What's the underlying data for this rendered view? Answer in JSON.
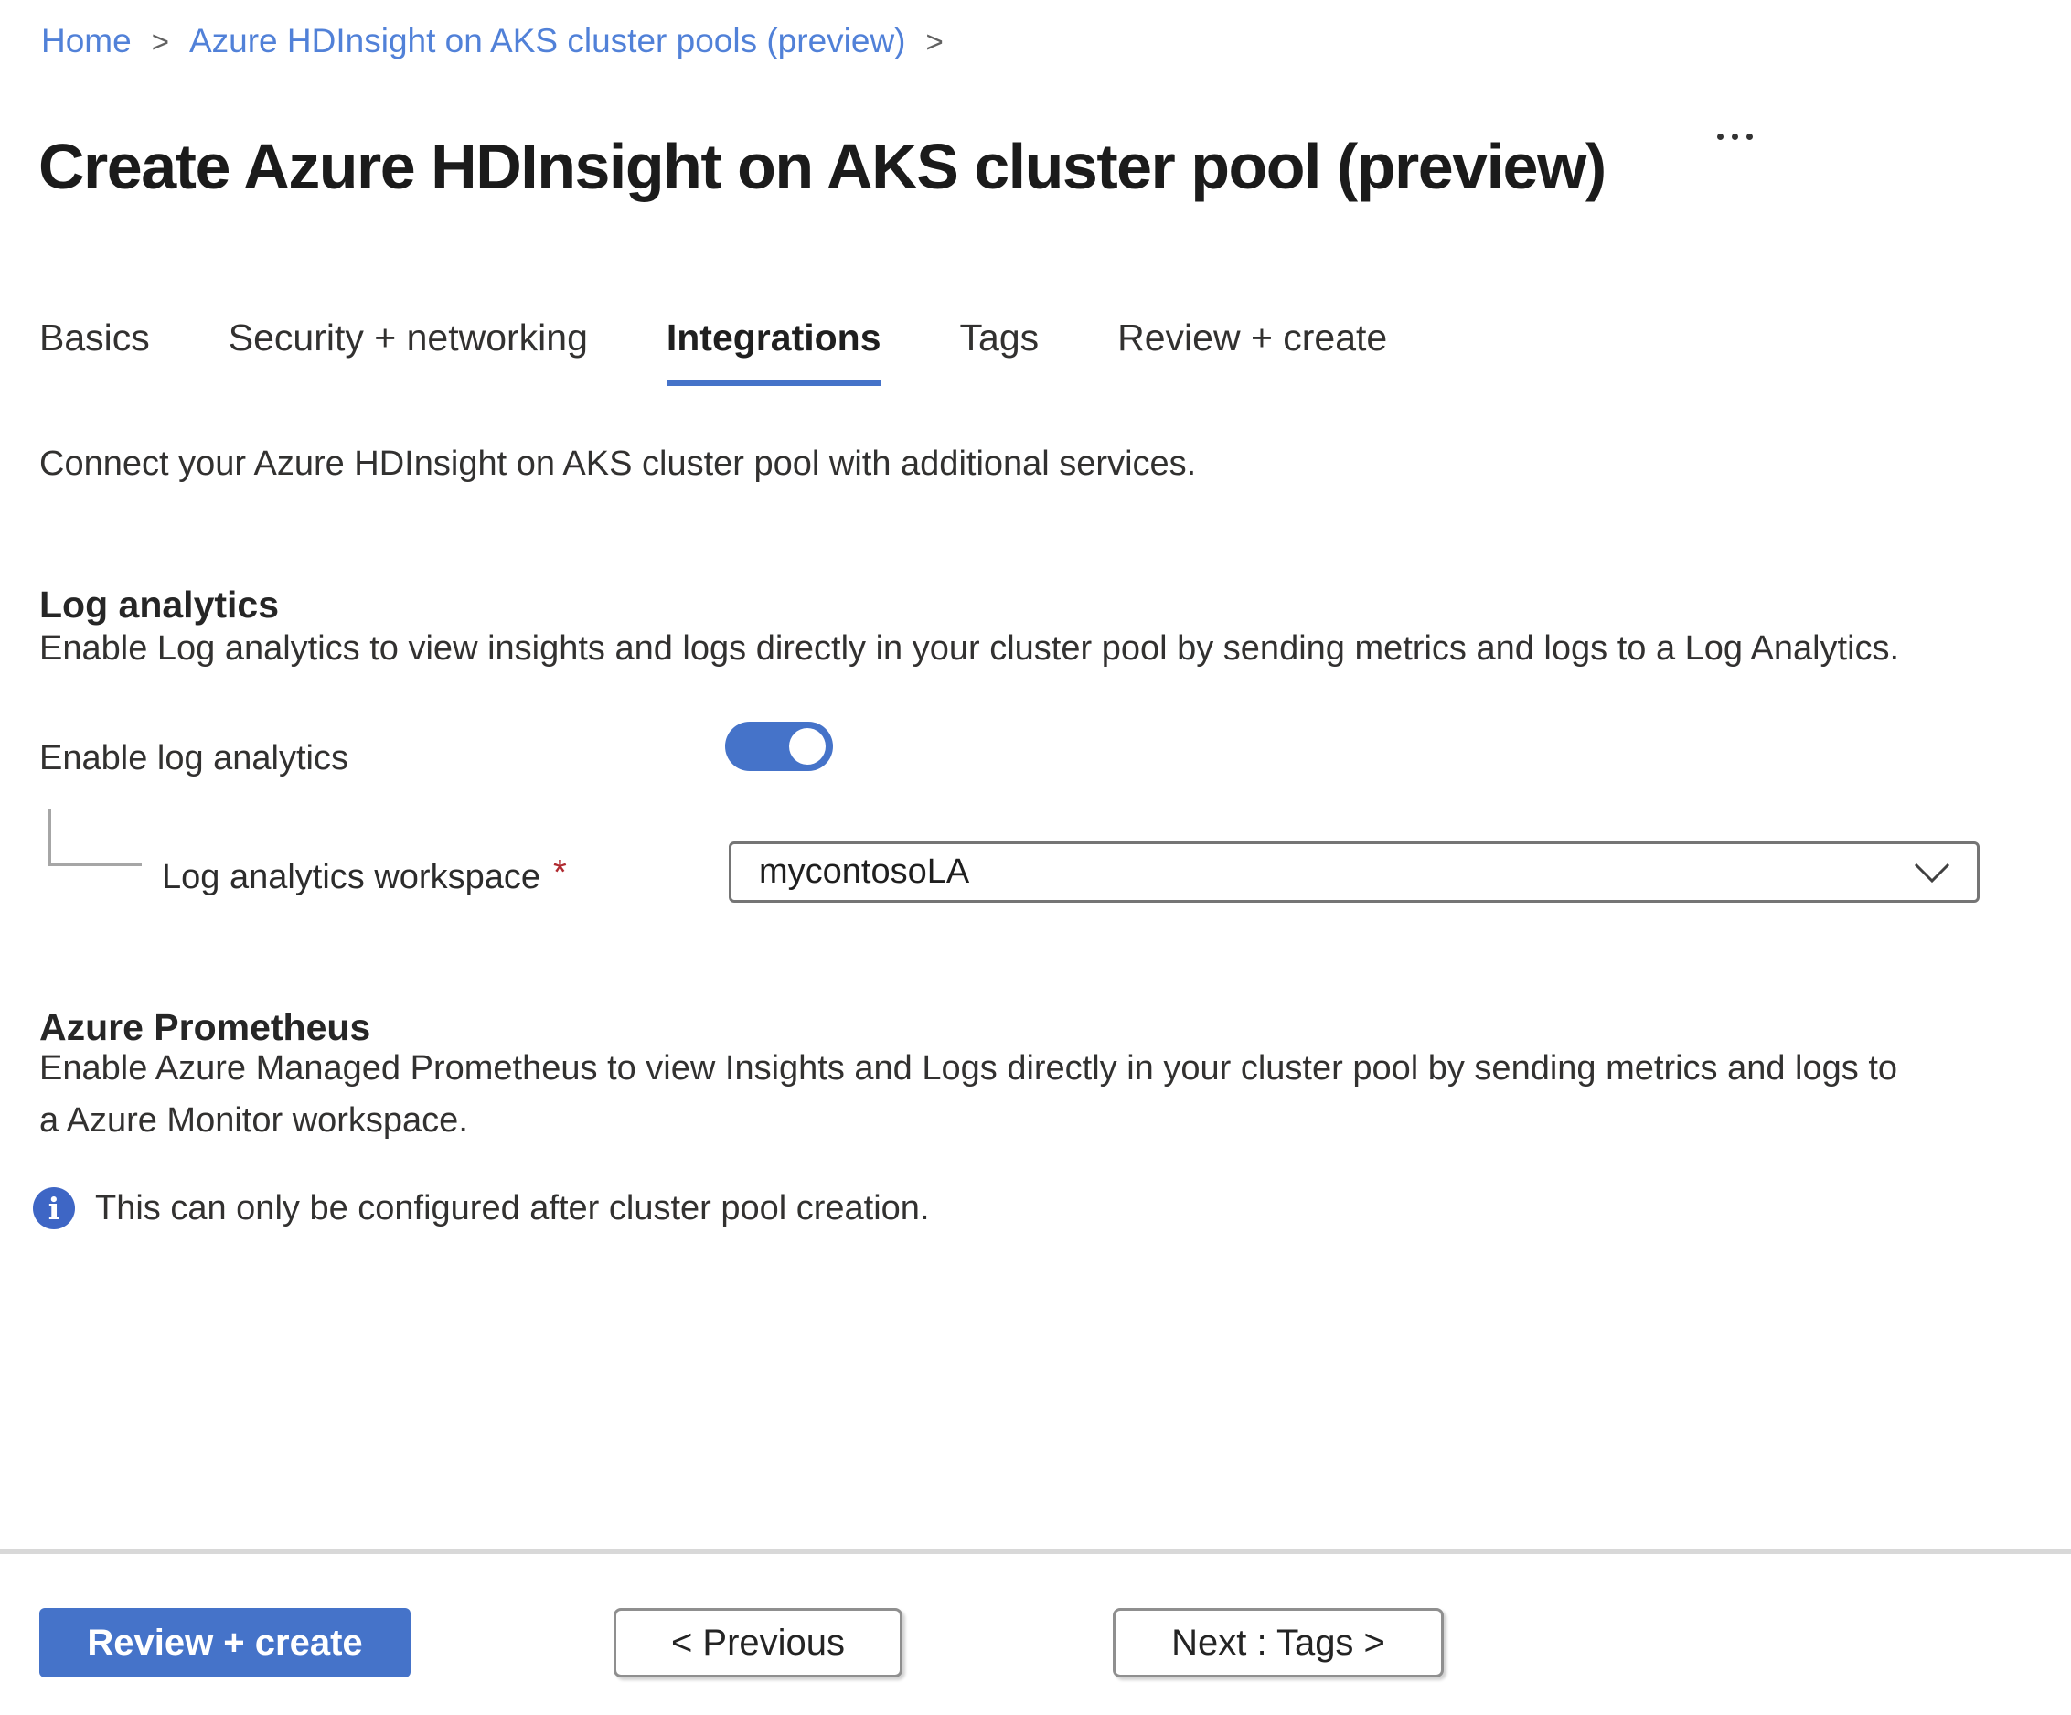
{
  "breadcrumb": {
    "separator": ">",
    "items": [
      {
        "label": "Home"
      },
      {
        "label": "Azure HDInsight on AKS cluster pools (preview)"
      }
    ]
  },
  "header": {
    "title": "Create Azure HDInsight on AKS cluster pool (preview)",
    "more_options_icon": "ellipsis-horizontal"
  },
  "tabs": [
    {
      "label": "Basics",
      "active": false
    },
    {
      "label": "Security + networking",
      "active": false
    },
    {
      "label": "Integrations",
      "active": true
    },
    {
      "label": "Tags",
      "active": false
    },
    {
      "label": "Review + create",
      "active": false
    }
  ],
  "intro": "Connect your Azure HDInsight on AKS cluster pool with additional services.",
  "log_analytics": {
    "heading": "Log analytics",
    "description": "Enable Log analytics to view insights and logs directly in your cluster pool by sending metrics and logs to a Log Analytics.",
    "toggle_label": "Enable log analytics",
    "toggle_state": "on",
    "workspace_label": "Log analytics workspace",
    "required_marker": "*",
    "workspace_value": "mycontosoLA"
  },
  "azure_prometheus": {
    "heading": "Azure Prometheus",
    "description_line1": "Enable Azure Managed Prometheus to view Insights and Logs directly in your cluster pool by sending metrics and logs to",
    "description_line2": "a Azure Monitor workspace.",
    "info_message": "This can only be configured after cluster pool creation."
  },
  "icons": {
    "info_glyph": "i"
  },
  "footer": {
    "review_create_label": "Review + create",
    "previous_label": "< Previous",
    "next_label": "Next : Tags >"
  },
  "colors": {
    "accent_blue": "#4573c9",
    "link_blue": "#5181d8",
    "info_icon_blue": "#3e66c5",
    "required_red": "#b02a30",
    "divider_gray": "#d8d8d8",
    "outline_button_border": "#8f8f8f"
  }
}
